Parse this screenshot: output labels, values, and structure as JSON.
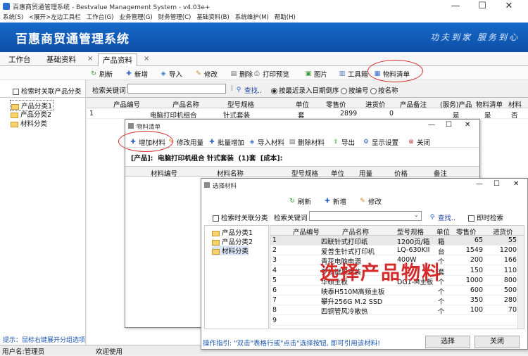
{
  "window": {
    "title": "百惠商贸通管理系统 - Bestvalue Management System - v4.03e+",
    "min": "—",
    "max": "☐",
    "close": "✕"
  },
  "menu": [
    "系统(S)",
    "<展开>左边工具栏",
    "工作台(G)",
    "业务管理(G)",
    "财务管理(C)",
    "基础资料(B)",
    "系统维护(M)",
    "帮助(H)"
  ],
  "banner": {
    "title": "百惠商贸通管理系统",
    "slogan": "功夫到家 服务到心"
  },
  "tabs": [
    {
      "label": "工作台"
    },
    {
      "label": "基础资料",
      "close": "×"
    },
    {
      "label": "产品资料",
      "close": "×"
    }
  ],
  "toolbar": [
    "刷新",
    "新增",
    "导入",
    "修改",
    "删除",
    "打印预览",
    "图片",
    "工具箱",
    "物料清单"
  ],
  "sidebar": {
    "checkbox": "检索时关联产品分类",
    "tree": [
      "产品分类1",
      "产品分类2",
      "材料分类"
    ],
    "hint": "提示：鼠标右键展开分组选项"
  },
  "search": {
    "label": "检索关键词",
    "btn": "查找..",
    "radios": [
      "按最近录入日期倒序",
      "按编号",
      "按名称"
    ]
  },
  "grid": {
    "headers": [
      "产品编号",
      "产品名称",
      "型号规格",
      "单位",
      "零售价",
      "进货价",
      "产品备注",
      "(服务)产品",
      "物料清单",
      "材料"
    ],
    "row": [
      "1",
      "",
      "电脑打印机组合",
      "针式套装",
      "套",
      "2899",
      "0",
      "",
      "是",
      "是",
      "否"
    ]
  },
  "status": {
    "user": "用户名:管理员",
    "welcome": "欢迎使用"
  },
  "bom": {
    "title": "物料清单",
    "toolbar": [
      "增加材料",
      "修改用量",
      "批量增加",
      "导入材料",
      "删除材料",
      "导出",
      "显示设置",
      "关闭"
    ],
    "info": "[产品]:  电脑打印机组合 针式套装  (1)套  [成本]:",
    "headers": [
      "材料编号",
      "材料名称",
      "型号规格",
      "单位",
      "用量",
      "价格",
      "备注"
    ]
  },
  "sel": {
    "title": "选择材料",
    "toolbar": [
      "刷新",
      "新增",
      "修改"
    ],
    "checkbox": "检索时关联分类",
    "search_label": "检索关键词",
    "find": "查找..",
    "instant": "即时检索",
    "tree": [
      "产品分类1",
      "产品分类2",
      "材料分类"
    ],
    "headers": [
      "产品编号",
      "产品名称",
      "型号规格",
      "单位",
      "零售价",
      "进货价"
    ],
    "rows": [
      [
        "1",
        "",
        "四联针式打印纸",
        "1200页/箱",
        "箱",
        "65",
        "55"
      ],
      [
        "2",
        "",
        "爱普生针式打印机",
        "LQ-630KII",
        "台",
        "1549",
        "1200"
      ],
      [
        "3",
        "",
        "青花电脑电源",
        "400W",
        "个",
        "200",
        "166"
      ],
      [
        "4",
        "",
        "罗技键鼠套装",
        "",
        "套",
        "150",
        "110"
      ],
      [
        "5",
        "",
        "华硕主板",
        "DG1-M主板",
        "个",
        "1000",
        "800"
      ],
      [
        "6",
        "",
        "映泰H510M高频主板",
        "",
        "个",
        "600",
        "500"
      ],
      [
        "7",
        "",
        "攀升256G M.2 SSD",
        "",
        "个",
        "350",
        "280"
      ],
      [
        "8",
        "",
        "四铜管风冷散热",
        "",
        "个",
        "100",
        "70"
      ],
      [
        "9",
        "",
        "",
        "",
        "",
        "",
        ""
      ]
    ],
    "overlay": "选择产品物料",
    "guide": "操作指引: \"双击\"表格行或\"点击\"选择按钮, 即可引用该材料!",
    "select": "选择",
    "close": "关闭"
  },
  "colors": {
    "banner": "#1669c8",
    "annotation": "#d42a2a"
  }
}
